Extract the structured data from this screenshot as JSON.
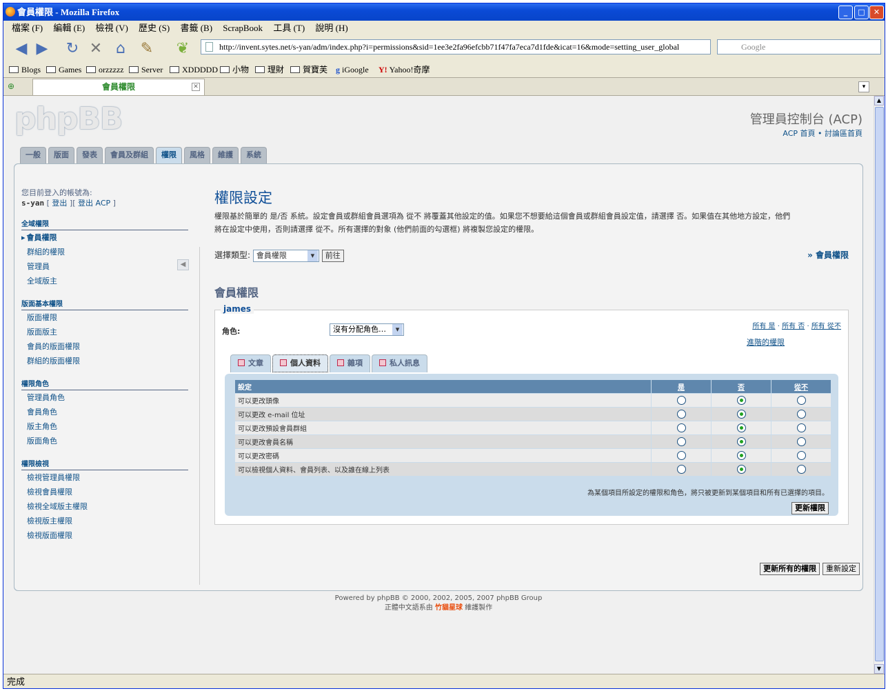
{
  "window": {
    "title": "會員權限 - Mozilla Firefox"
  },
  "menu": [
    "檔案 (F)",
    "編輯 (E)",
    "檢視 (V)",
    "歷史 (S)",
    "書籤 (B)",
    "ScrapBook",
    "工具 (T)",
    "說明 (H)"
  ],
  "url": "http://invent.sytes.net/s-yan/adm/index.php?i=permissions&sid=1ee3e2fa96efcbb71f47fa7eca7d1fde&icat=16&mode=setting_user_global",
  "search_placeholder": "Google",
  "bookmarks": [
    "Blogs",
    "Games",
    "orzzzzz",
    "Server",
    "XDDDDD",
    "小物",
    "理財",
    "賀寶芙",
    "iGoogle",
    "Yahoo!奇摩"
  ],
  "tab_title": "會員權限",
  "status": "完成",
  "acp": {
    "logo": "phpBB",
    "title": "管理員控制台 (ACP)",
    "link_home": "ACP 首頁",
    "link_forum": "討論區首頁",
    "tabs": [
      "一般",
      "版面",
      "發表",
      "會員及群組",
      "權限",
      "風格",
      "維護",
      "系統"
    ]
  },
  "sidebar": {
    "logged_label": "您目前登入的帳號為:",
    "user": "s-yan",
    "logout": "登出",
    "logout_acp": "登出 ACP",
    "sections": [
      {
        "title": "全域權限",
        "items": [
          "會員權限",
          "群組的權限",
          "管理員",
          "全域版主"
        ]
      },
      {
        "title": "版面基本權限",
        "items": [
          "版面權限",
          "版面版主",
          "會員的版面權限",
          "群組的版面權限"
        ]
      },
      {
        "title": "權限角色",
        "items": [
          "管理員角色",
          "會員角色",
          "版主角色",
          "版面角色"
        ]
      },
      {
        "title": "權限檢視",
        "items": [
          "檢視管理員權限",
          "檢視會員權限",
          "檢視全域版主權限",
          "檢視版主權限",
          "檢視版面權限"
        ]
      }
    ]
  },
  "main": {
    "title": "權限設定",
    "desc1": "權限基於簡單的 是/否 系統。設定會員或群組會員選項為 從不 將覆蓋其他設定的值。如果您不想要給這個會員或群組會員設定值，請選擇 否。如果值在其他地方設定，他們",
    "desc2": "將在設定中使用，否則請選擇 從不。所有選擇的對象 (他們前面的勾選框) 將複製您設定的權限。",
    "select_label": "選擇類型:",
    "select_value": "會員權限",
    "go": "前往",
    "crumb": "» 會員權限",
    "section_title": "會員權限",
    "user": "james",
    "role_label": "角色:",
    "role_value": "沒有分配角色…",
    "all_yes": "所有 是",
    "all_no": "所有 否",
    "all_never": "所有 從不",
    "advanced": "進階的權限",
    "perm_tabs": [
      "文章",
      "個人資料",
      "雜項",
      "私人訊息"
    ],
    "col_setting": "設定",
    "col_yes": "是",
    "col_no": "否",
    "col_never": "從不",
    "rows": [
      {
        "label": "可以更改頭像",
        "value": "no"
      },
      {
        "label": "可以更改 e-mail 位址",
        "value": "no"
      },
      {
        "label": "可以更改預設會員群組",
        "value": "no"
      },
      {
        "label": "可以更改會員名稱",
        "value": "no"
      },
      {
        "label": "可以更改密碼",
        "value": "no"
      },
      {
        "label": "可以檢視個人資料、會員列表、以及誰在線上列表",
        "value": "no"
      }
    ],
    "note": "為某個項目所設定的權限和角色，將只被更新到某個項目和所有已選擇的項目。",
    "update": "更新權限",
    "update_all": "更新所有的權限",
    "reset": "重新設定"
  },
  "footer": {
    "line1": "Powered by phpBB © 2000, 2002, 2005, 2007 phpBB Group",
    "line2_a": "正體中文語系由",
    "line2_b": "竹貓星球",
    "line2_c": "維護製作"
  }
}
